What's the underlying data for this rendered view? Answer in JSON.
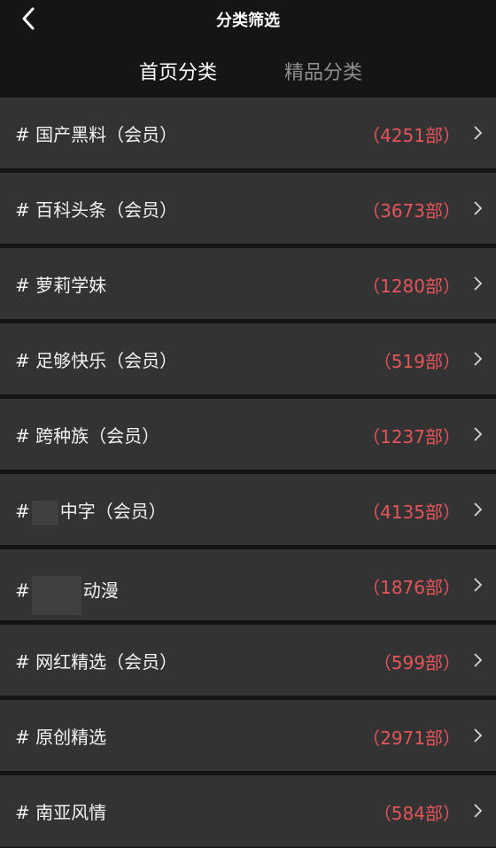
{
  "header": {
    "title": "分类筛选",
    "tabs": [
      {
        "label": "首页分类",
        "active": true
      },
      {
        "label": "精品分类",
        "active": false
      }
    ]
  },
  "categories": [
    {
      "label": "# 国产黑料（会员）",
      "count": "（4251部）"
    },
    {
      "label": "# 百科头条（会员）",
      "count": "（3673部）"
    },
    {
      "label": "# 萝莉学妹",
      "count": "（1280部）"
    },
    {
      "label": "# 足够快乐（会员）",
      "count": "（519部）"
    },
    {
      "label": "# 跨种族（会员）",
      "count": "（1237部）"
    },
    {
      "label_prefix": "#",
      "label_suffix": "中字（会员）",
      "count": "（4135部）"
    },
    {
      "label_prefix": "#",
      "label_suffix": "动漫",
      "count": "（1876部）"
    },
    {
      "label": "# 网红精选（会员）",
      "count": "（599部）"
    },
    {
      "label": "# 原创精选",
      "count": "（2971部）"
    },
    {
      "label": "# 南亚风情",
      "count": "（584部）"
    }
  ],
  "colors": {
    "accent": "#e4555b",
    "row_bg": "#333333",
    "header_bg": "#151515"
  },
  "icons": {
    "back": "chevron-left-icon",
    "row_arrow": "chevron-right-icon"
  }
}
